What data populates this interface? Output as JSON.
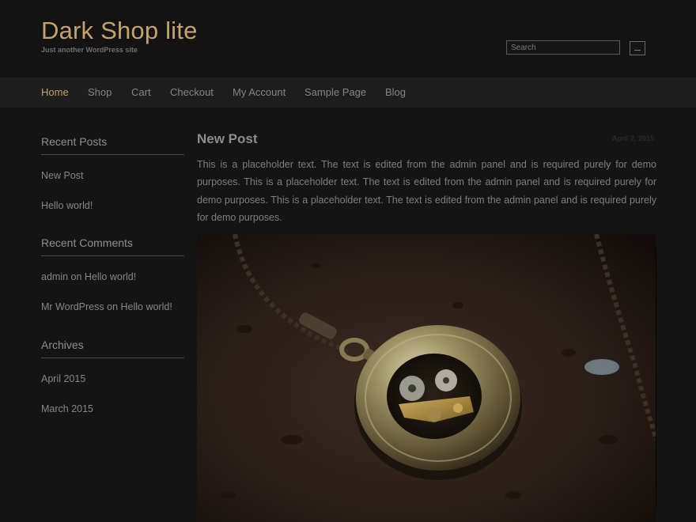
{
  "site": {
    "title": "Dark Shop lite",
    "tagline": "Just another WordPress site"
  },
  "search": {
    "placeholder": "Search",
    "button_icon": "search-submit-icon"
  },
  "nav": {
    "items": [
      {
        "label": "Home",
        "active": true
      },
      {
        "label": "Shop",
        "active": false
      },
      {
        "label": "Cart",
        "active": false
      },
      {
        "label": "Checkout",
        "active": false
      },
      {
        "label": "My Account",
        "active": false
      },
      {
        "label": "Sample Page",
        "active": false
      },
      {
        "label": "Blog",
        "active": false
      }
    ]
  },
  "sidebar": {
    "recent_posts": {
      "title": "Recent Posts",
      "items": [
        "New Post",
        "Hello world!"
      ]
    },
    "recent_comments": {
      "title": "Recent Comments",
      "items": [
        "admin on Hello world!",
        "Mr WordPress on Hello world!"
      ]
    },
    "archives": {
      "title": "Archives",
      "items": [
        "April 2015",
        "March 2015"
      ]
    }
  },
  "post": {
    "title": "New Post",
    "date": "April 2, 2015",
    "body": "This is a placeholder text. The text is edited from the admin panel and is required purely for demo purposes. This is a placeholder text. The text is edited from the admin panel and is required purely for demo purposes. This is a placeholder text. The text is edited from the admin panel and is required purely for demo purposes.",
    "image": "pocket-watch-photo"
  },
  "colors": {
    "accent": "#c7a26c",
    "background": "#141414",
    "nav_background": "#1d1d1d",
    "text": "#8a8a8a"
  }
}
